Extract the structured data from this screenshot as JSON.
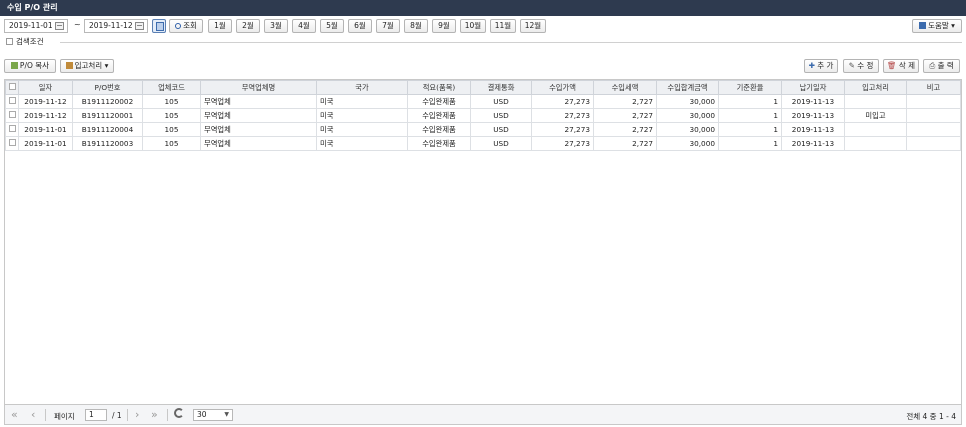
{
  "title": "수입 P/O 관리",
  "search": {
    "date_from": "2019-11-01",
    "date_to": "2019-11-12",
    "range_sep": "~",
    "search_label": "조회",
    "months": [
      "1월",
      "2월",
      "3월",
      "4월",
      "5월",
      "6월",
      "7월",
      "8월",
      "9월",
      "10월",
      "11월",
      "12월"
    ],
    "help_label": "도움말"
  },
  "condition": {
    "label": "검색조건"
  },
  "actions": {
    "copy_label": "P/O 복사",
    "receive_label": "입고처리",
    "add_label": "추 가",
    "edit_label": "수 정",
    "delete_label": "삭 제",
    "print_label": "출 력"
  },
  "table": {
    "columns": [
      "일자",
      "P/O번호",
      "업체코드",
      "무역업체명",
      "국가",
      "적요(품목)",
      "결제통화",
      "수입가액",
      "수입세액",
      "수입합계금액",
      "기준환율",
      "납기일자",
      "입고처리",
      "비고"
    ],
    "rows": [
      [
        "2019-11-12",
        "B1911120002",
        "105",
        "무역업체",
        "미국",
        "수입완제품",
        "USD",
        "27,273",
        "2,727",
        "30,000",
        "1",
        "2019-11-13",
        "",
        ""
      ],
      [
        "2019-11-12",
        "B1911120001",
        "105",
        "무역업체",
        "미국",
        "수입완제품",
        "USD",
        "27,273",
        "2,727",
        "30,000",
        "1",
        "2019-11-13",
        "미입고",
        ""
      ],
      [
        "2019-11-01",
        "B1911120004",
        "105",
        "무역업체",
        "미국",
        "수입완제품",
        "USD",
        "27,273",
        "2,727",
        "30,000",
        "1",
        "2019-11-13",
        "",
        ""
      ],
      [
        "2019-11-01",
        "B1911120003",
        "105",
        "무역업체",
        "미국",
        "수입완제품",
        "USD",
        "27,273",
        "2,727",
        "30,000",
        "1",
        "2019-11-13",
        "",
        ""
      ]
    ]
  },
  "pager": {
    "page_label": "페이지",
    "page": "1",
    "of_pages": "/ 1",
    "page_size": "30",
    "total_text": "전체 4 중 1 - 4"
  },
  "colors": {
    "titlebar": "#2e3a4f",
    "accent": "#3c6bad"
  }
}
